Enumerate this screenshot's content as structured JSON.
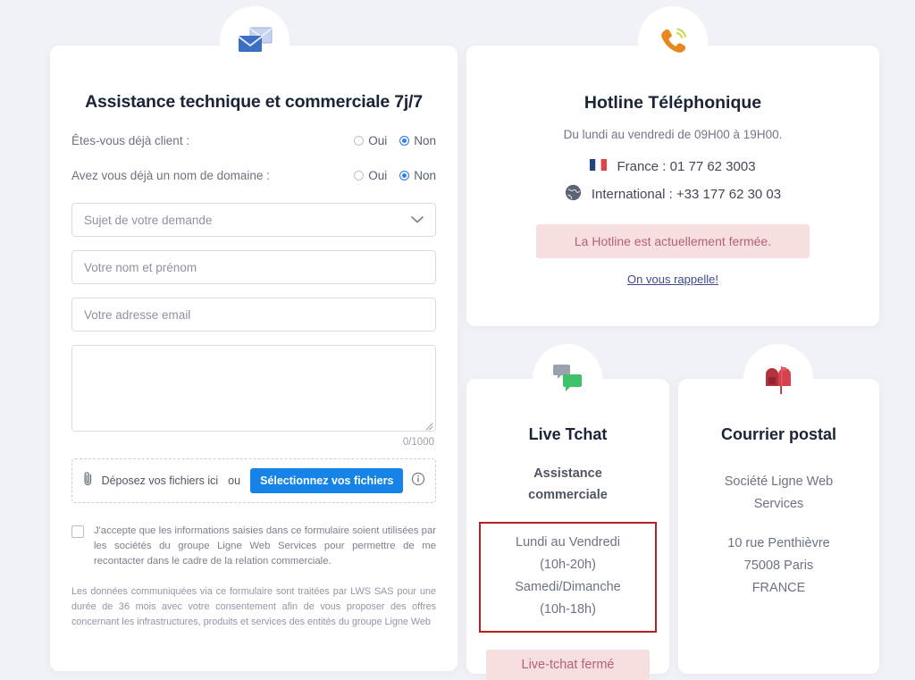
{
  "theme": {
    "page_bg": "#f1f2f7",
    "card_bg": "#ffffff",
    "heading": "#1b2337",
    "accent_blue": "#1683e8",
    "radio_blue": "#2f80ed",
    "alert_bg": "#f8dfdf",
    "alert_text": "#b4626f",
    "hours_border": "#b22222",
    "link": "#3e4a8c"
  },
  "form": {
    "icon": "envelopes-icon",
    "title": "Assistance technique et commerciale 7j/7",
    "questions": [
      {
        "label": "Êtes-vous déjà client :",
        "options": [
          {
            "label": "Oui",
            "checked": false
          },
          {
            "label": "Non",
            "checked": true
          }
        ]
      },
      {
        "label": "Avez vous déjà un nom de domaine :",
        "options": [
          {
            "label": "Oui",
            "checked": false
          },
          {
            "label": "Non",
            "checked": true
          }
        ]
      }
    ],
    "subject_select": {
      "value": "Sujet de votre demande",
      "icon": "chevron-down-icon"
    },
    "name_input": {
      "placeholder": "Votre nom et prénom",
      "value": ""
    },
    "email_input": {
      "placeholder": "Votre adresse email",
      "value": ""
    },
    "message_textarea": {
      "placeholder": "",
      "value": ""
    },
    "char_counter": "0/1000",
    "dropzone": {
      "icon": "paperclip-icon",
      "text": "Déposez vos fichiers ici",
      "or": "ou",
      "button": "Sélectionnez vos fichiers",
      "info_icon": "info-icon"
    },
    "consent": {
      "checked": false,
      "text": "J'accepte que les informations saisies dans ce formulaire soient utilisées par les sociétés du groupe Ligne Web Services pour permettre de me recontacter dans le cadre de la relation commerciale."
    },
    "privacy_text": "Les données communiquées via ce formulaire sont traitées par LWS SAS pour une durée de 36 mois avec votre consentement afin de vous proposer des offres concernant les infrastructures, produits et services des entités du groupe Ligne Web"
  },
  "hotline": {
    "icon": "phone-ringing-icon",
    "title": "Hotline Téléphonique",
    "subtitle": "Du lundi au vendredi de 09H00 à 19H00.",
    "phones": [
      {
        "icon": "france-flag-icon",
        "text": "France : 01 77 62 3003"
      },
      {
        "icon": "globe-icon",
        "text": "International : +33 177 62 30 03"
      }
    ],
    "alert": "La Hotline est actuellement fermée.",
    "recall_link": "On vous rappelle!"
  },
  "tchat": {
    "icon": "chat-bubbles-icon",
    "title": "Live Tchat",
    "subtitle_line1": "Assistance",
    "subtitle_line2": "commerciale",
    "hours": [
      "Lundi au Vendredi",
      "(10h-20h)",
      "Samedi/Dimanche",
      "(10h-18h)"
    ],
    "badge": "Live-tchat fermé"
  },
  "postal": {
    "icon": "mailbox-icon",
    "title": "Courrier postal",
    "company_line1": "Société Ligne Web",
    "company_line2": "Services",
    "address_line1": "10 rue Penthièvre",
    "address_line2": "75008 Paris",
    "address_line3": "FRANCE"
  }
}
